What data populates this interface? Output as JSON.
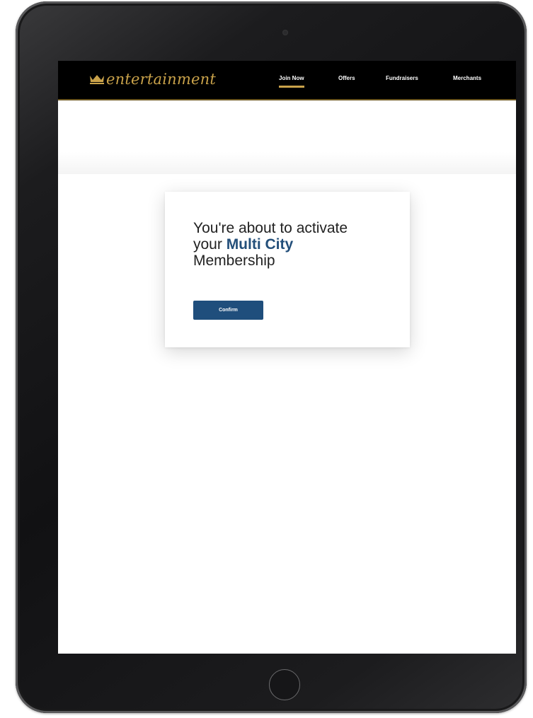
{
  "app": {
    "brand_name": "entertainment",
    "brand_color": "#c9a24a"
  },
  "nav": {
    "items": [
      {
        "label": "Join Now",
        "active": true
      },
      {
        "label": "Offers",
        "active": false
      },
      {
        "label": "Fundraisers",
        "active": false
      },
      {
        "label": "Merchants",
        "active": false
      }
    ]
  },
  "modal": {
    "title_part1": "You're about to activate your ",
    "title_highlight": "Multi City",
    "title_part2": " Membership",
    "confirm_label": "Confirm",
    "accent_color": "#234f7a",
    "button_color": "#1f4e7c"
  },
  "icons": {
    "logo": "crown-icon"
  }
}
